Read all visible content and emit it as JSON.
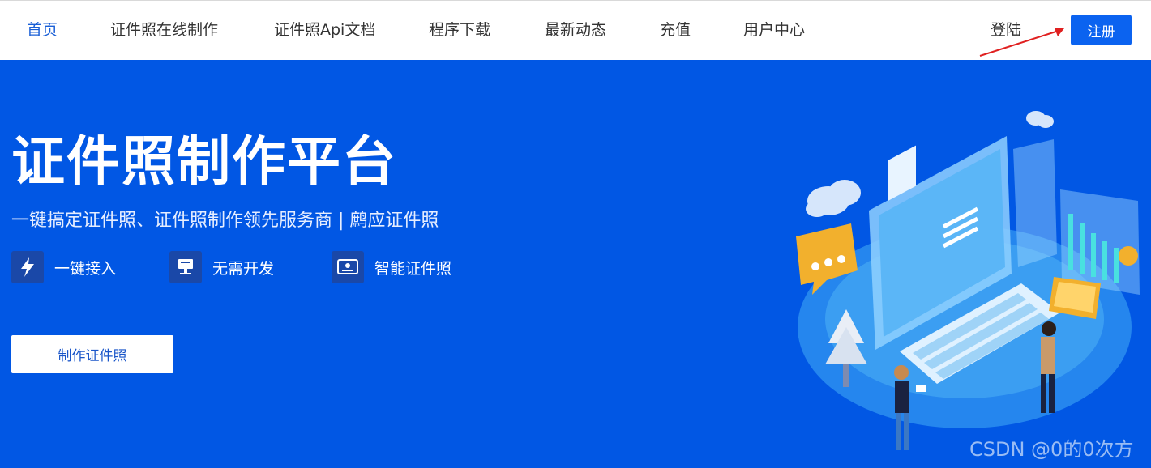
{
  "nav": {
    "items": [
      {
        "label": "首页",
        "active": true
      },
      {
        "label": "证件照在线制作"
      },
      {
        "label": "证件照Api文档"
      },
      {
        "label": "程序下载"
      },
      {
        "label": "最新动态"
      },
      {
        "label": "充值"
      },
      {
        "label": "用户中心"
      }
    ],
    "login_label": "登陆",
    "register_label": "注册"
  },
  "hero": {
    "title": "证件照制作平台",
    "subtitle": "一键搞定证件照、证件照制作领先服务商 | 鹧应证件照",
    "features": [
      {
        "icon": "lightning-icon",
        "label": "一键接入"
      },
      {
        "icon": "computer-icon",
        "label": "无需开发"
      },
      {
        "icon": "id-card-icon",
        "label": "智能证件照"
      }
    ],
    "cta_label": "制作证件照"
  },
  "watermark": "CSDN @0的0次方",
  "colors": {
    "hero_bg": "#0157e4",
    "accent": "#0b63f0",
    "active_nav": "#1a5fd6",
    "annotation_arrow": "#e02020"
  }
}
